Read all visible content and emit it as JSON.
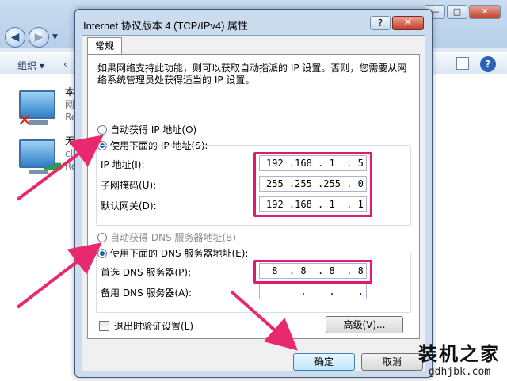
{
  "background_window": {
    "toolbar_organize": "组织 ▾",
    "toolbar_item2": "‹",
    "connections": [
      {
        "name": "本",
        "sub1": "网",
        "sub2": "Re"
      },
      {
        "name": "无",
        "sub1": "cl",
        "sub2": "Re"
      }
    ],
    "title_buttons": [
      "—",
      "□",
      "✕"
    ]
  },
  "dialog": {
    "title": "Internet 协议版本 4 (TCP/IPv4) 属性",
    "help_glyph": "?",
    "close_glyph": "✕",
    "tab_label": "常规",
    "description": "如果网络支持此功能，则可以获取自动指派的 IP 设置。否则，您需要从网络系统管理员处获得适当的 IP 设置。",
    "ip_auto_label": "自动获得 IP 地址(O)",
    "ip_manual_label": "使用下面的 IP 地址(S):",
    "ip_address_label": "IP 地址(I):",
    "ip_address_value": "192 .168 . 1  . 5",
    "subnet_label": "子网掩码(U):",
    "subnet_value": "255 .255 .255 . 0",
    "gateway_label": "默认网关(D):",
    "gateway_value": "192 .168 . 1  . 1",
    "dns_auto_label": "自动获得 DNS 服务器地址(B)",
    "dns_manual_label": "使用下面的 DNS 服务器地址(E):",
    "preferred_dns_label": "首选 DNS 服务器(P):",
    "preferred_dns_value": " 8  . 8  . 8  . 8",
    "alternate_dns_label": "备用 DNS 服务器(A):",
    "alternate_dns_value": "      .    .    .",
    "validate_label": "退出时验证设置(L)",
    "advanced_label": "高级(V)...",
    "ok_label": "确定",
    "cancel_label": "取消"
  },
  "watermark": {
    "title": "装机之家",
    "url": "gdhjbk.com"
  },
  "colors": {
    "highlight": "#e01a73",
    "arrow": "#e8286f"
  }
}
